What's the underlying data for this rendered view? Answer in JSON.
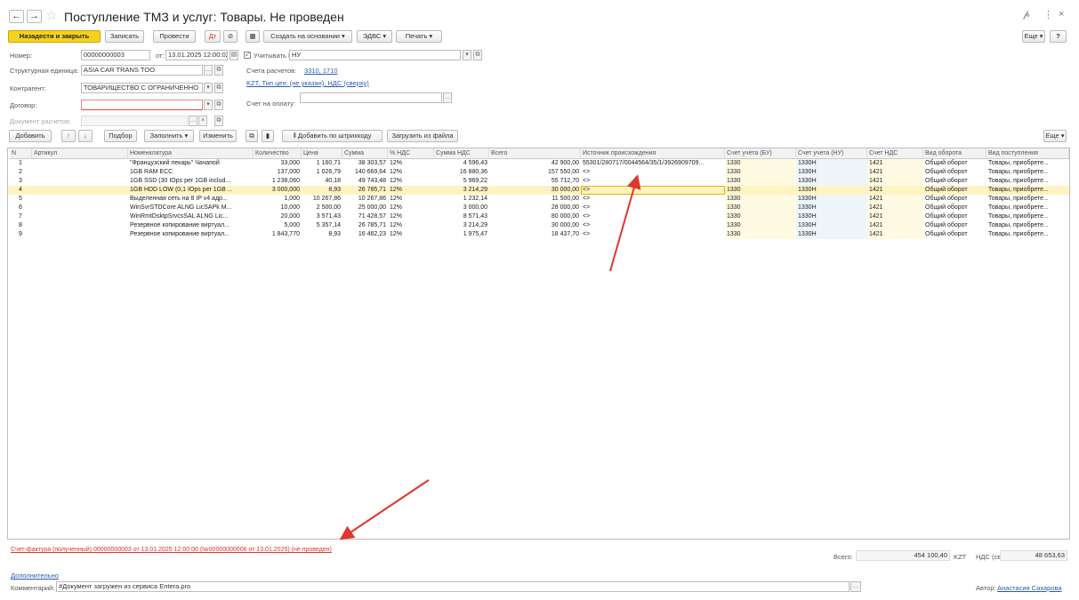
{
  "title": "Поступление ТМЗ и услуг: Товары. Не проведен",
  "nav": {
    "back": "←",
    "forward": "→",
    "star": "☆"
  },
  "window": {
    "link": "𝓅",
    "more": "⋮",
    "close": "×"
  },
  "toolbar": {
    "back_close": "Назад",
    "back_close2": "ести и закрыть",
    "save": "Записать",
    "post": "Провести",
    "create_based": "Создать на основании ▾",
    "edvs": "ЭДВС ▾",
    "print": "Печать ▾",
    "more": "Еще ▾",
    "help": "?"
  },
  "form": {
    "number_label": "Номер:",
    "number_value": "00000000003",
    "from_label": "от:",
    "date_value": "13.01.2025 12:00:02",
    "kpn_label": "Учитывать КПН:",
    "kpn_value": "НУ",
    "struct_label": "Структурная единица:",
    "struct_value": "ASIA CAR TRANS TOO",
    "counterparty_label": "Контрагент:",
    "counterparty_value": "ТОВАРИЩЕСТВО С ОГРАНИЧЕННО",
    "contract_label": "Договор:",
    "contract_value": "",
    "settle_doc_label": "Документ расчетов:",
    "accounts_label": "Счета расчетов:",
    "accounts_value": "3310, 1710",
    "currency_link": "KZT, Тип цен: (не указан), НДС (сверху)",
    "invoice_label": "Счет на оплату:"
  },
  "table_toolbar": {
    "add": "Добавить",
    "up": "↑",
    "down": "↓",
    "pick": "Подбор",
    "fill": "Заполнить ▾",
    "change": "Изменить",
    "barcode": "Добавить по штрихкоду",
    "load_file": "Загрузить из файла",
    "more": "Еще ▾"
  },
  "columns": [
    "N",
    "Артикул",
    "Номенклатура",
    "Количество",
    "Цена",
    "Сумма",
    "% НДС",
    "Сумма НДС",
    "Всего",
    "Источник происхождения",
    "Счет учета (БУ)",
    "Счет учета (НУ)",
    "Счет НДС",
    "Вид оборота",
    "Вид поступления"
  ],
  "rows": [
    [
      "1",
      "",
      "\"Французский пекарь\" Чачапой",
      "33,000",
      "1 160,71",
      "38 303,57",
      "12%",
      "4 596,43",
      "42 900,00",
      "55301/280717/0044564/35/1/3926909709...",
      "1330",
      "1330Н",
      "1421",
      "Общий оборот",
      "Товары, приобрете..."
    ],
    [
      "2",
      "",
      "1GB RAM ECC",
      "137,000",
      "1 026,79",
      "140 669,64",
      "12%",
      "16 880,36",
      "157 550,00",
      "<>",
      "1330",
      "1330Н",
      "1421",
      "Общий оборот",
      "Товары, приобрете..."
    ],
    [
      "3",
      "",
      "1GB SSD (30 IOps per 1GB includ...",
      "1 238,060",
      "40,18",
      "49 743,48",
      "12%",
      "5 969,22",
      "55 712,70",
      "<>",
      "1330",
      "1330Н",
      "1421",
      "Общий оборот",
      "Товары, приобрете..."
    ],
    [
      "4",
      "",
      "1GB HDD LOW (0,1 IOps per 1GB ...",
      "3 000,000",
      "8,93",
      "26 785,71",
      "12%",
      "3 214,29",
      "30 000,00",
      "<>",
      "1330",
      "1330Н",
      "1421",
      "Общий оборот",
      "Товары, приобрете..."
    ],
    [
      "5",
      "",
      "Выделенная сеть на 8 IP v4 адр...",
      "1,000",
      "10 267,86",
      "10 267,86",
      "12%",
      "1 232,14",
      "11 500,00",
      "<>",
      "1330",
      "1330Н",
      "1421",
      "Общий оборот",
      "Товары, приобрете..."
    ],
    [
      "6",
      "",
      "WinSvrSTDCore ALNG LicSAPk M...",
      "10,000",
      "2 500,00",
      "25 000,00",
      "12%",
      "3 000,00",
      "28 000,00",
      "<>",
      "1330",
      "1330Н",
      "1421",
      "Общий оборот",
      "Товары, приобрете..."
    ],
    [
      "7",
      "",
      "WinRmtDsktpSrvcsSAL ALNG Lic...",
      "20,000",
      "3 571,43",
      "71 428,57",
      "12%",
      "8 571,43",
      "80 000,00",
      "<>",
      "1330",
      "1330Н",
      "1421",
      "Общий оборот",
      "Товары, приобрете..."
    ],
    [
      "8",
      "",
      "Резервное копирование виртуал...",
      "5,000",
      "5 357,14",
      "26 785,71",
      "12%",
      "3 214,29",
      "30 000,00",
      "<>",
      "1330",
      "1330Н",
      "1421",
      "Общий оборот",
      "Товары, приобрете..."
    ],
    [
      "9",
      "",
      "Резервное копирование виртуал...",
      "1 843,770",
      "8,93",
      "16 462,23",
      "12%",
      "1 975,47",
      "18 437,70",
      "<>",
      "1330",
      "1330Н",
      "1421",
      "Общий оборот",
      "Товары, приобрете..."
    ]
  ],
  "selected_row": 3,
  "footer": {
    "invoice_link": "Счет-фактура (полученный) 00000000003 от 13.01.2025 12:00:00 (№00000000006 от 13.01.2025) (не проведен)",
    "total_label": "Всего:",
    "total_value": "454 100,40",
    "currency": "KZT",
    "vat_label": "НДС (сверху):",
    "vat_value": "48 653,63",
    "extra_link": "Дополнительно",
    "comment_label": "Комментарий:",
    "comment_value": "#Документ загружен из сервиса Entera.pro",
    "author_label": "Автор:",
    "author_value": "Анастасия Сахарова"
  },
  "colors": {
    "accent": "#f4d21f",
    "arrow": "#e0362b",
    "link": "#2a5bb5"
  }
}
